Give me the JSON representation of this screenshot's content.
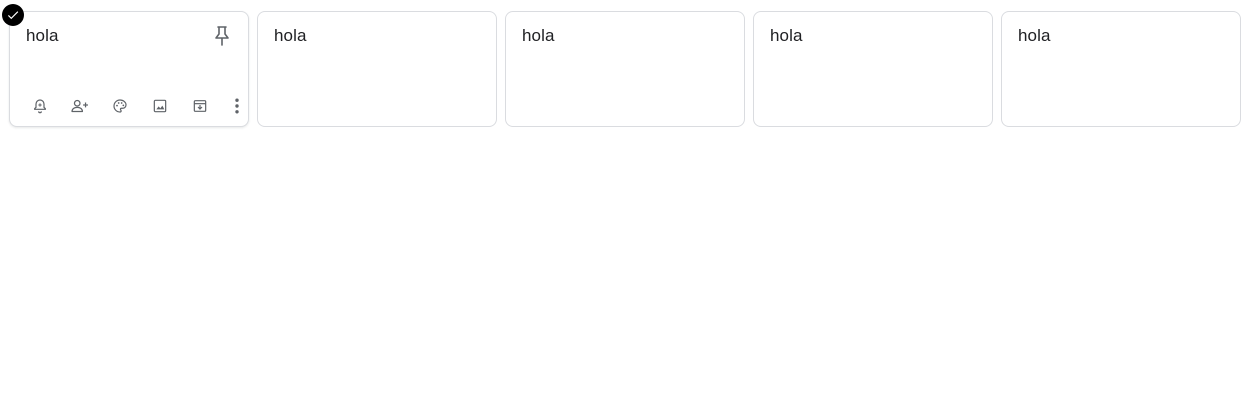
{
  "notes": [
    {
      "title": "hola"
    },
    {
      "title": "hola"
    },
    {
      "title": "hola"
    },
    {
      "title": "hola"
    },
    {
      "title": "hola"
    }
  ],
  "icons": {
    "selected": "check-circle-icon",
    "pin": "pin-icon",
    "toolbar": [
      "remind-icon",
      "collaborator-icon",
      "palette-icon",
      "image-icon",
      "archive-icon",
      "more-vert-icon"
    ]
  },
  "colors": {
    "border": "#dadce0",
    "text": "#202124",
    "icon": "#5f6368",
    "check_bg": "#000000"
  }
}
